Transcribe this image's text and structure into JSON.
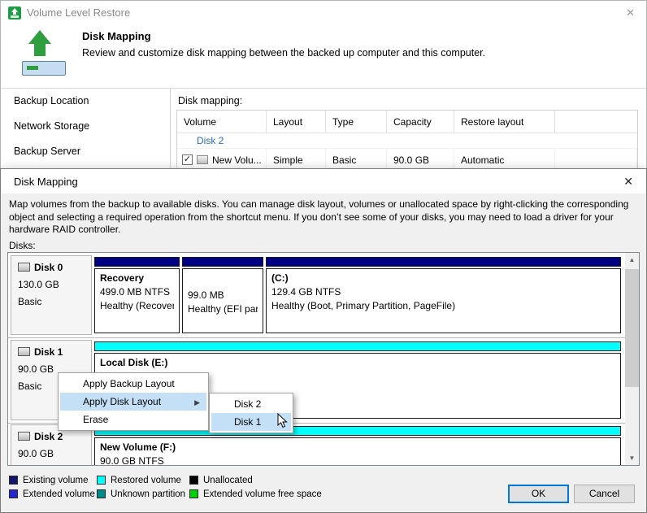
{
  "icons": {
    "close": "✕",
    "submenu_arrow": "▶",
    "scroll_up": "▲",
    "scroll_down": "▼",
    "checkmark": "✓"
  },
  "background": {
    "window_title": "Volume Level Restore",
    "header": {
      "title": "Disk Mapping",
      "description": "Review and customize disk mapping between the backed up computer and this computer."
    },
    "sidebar": {
      "items": [
        {
          "label": "Backup Location"
        },
        {
          "label": "Network Storage"
        },
        {
          "label": "Backup Server"
        }
      ]
    },
    "table": {
      "label": "Disk mapping:",
      "columns": [
        {
          "label": "Volume"
        },
        {
          "label": "Layout"
        },
        {
          "label": "Type"
        },
        {
          "label": "Capacity"
        },
        {
          "label": "Restore layout"
        }
      ],
      "group_row": {
        "label": "Disk 2"
      },
      "row": {
        "volume": "New Volu...",
        "layout": "Simple",
        "type": "Basic",
        "capacity": "90.0 GB",
        "restore_layout": "Automatic",
        "checked": true
      }
    }
  },
  "dialog": {
    "title": "Disk Mapping",
    "description": "Map volumes from the backup to available disks. You can manage disk layout, volumes or unallocated space by right-clicking the corresponding object and selecting a required operation from the shortcut menu. If you don’t see some of your disks, you may need to load a driver for your hardware RAID controller.",
    "disks_label": "Disks:",
    "disks": [
      {
        "name": "Disk 0",
        "size": "130.0 GB",
        "kind": "Basic",
        "partitions": [
          {
            "name": "Recovery",
            "size": "499.0 MB NTFS",
            "status": "Healthy (Recovery",
            "color": "#000082"
          },
          {
            "name": "",
            "size": "99.0 MB",
            "status": "Healthy (EFI parti",
            "color": "#000082"
          },
          {
            "name": "(C:)",
            "size": "129.4 GB NTFS",
            "status": "Healthy (Boot, Primary Partition, PageFile)",
            "color": "#000082"
          }
        ]
      },
      {
        "name": "Disk 1",
        "size": "90.0 GB",
        "kind": "Basic",
        "partitions": [
          {
            "name": "Local Disk (E:)",
            "size": "",
            "status": "",
            "color": "#00ffff"
          }
        ]
      },
      {
        "name": "Disk 2",
        "size": "90.0 GB",
        "kind": "Basic",
        "partitions": [
          {
            "name": "New Volume (F:)",
            "size": "90.0 GB NTFS",
            "status": "",
            "color": "#00ffff"
          }
        ]
      }
    ],
    "context_menu": {
      "items": [
        {
          "label": "Apply Backup Layout"
        },
        {
          "label": "Apply Disk Layout"
        },
        {
          "label": "Erase"
        }
      ],
      "highlighted": "Apply Disk Layout"
    },
    "submenu": {
      "items": [
        {
          "label": "Disk 2"
        },
        {
          "label": "Disk 1"
        }
      ],
      "highlighted": "Disk 1"
    },
    "legend": {
      "row1": [
        {
          "label": "Existing volume",
          "color": "#15156b"
        },
        {
          "label": "Restored volume",
          "color": "#00ffff"
        },
        {
          "label": "Unallocated",
          "color": "#000000"
        }
      ],
      "row2": [
        {
          "label": "Extended volume",
          "color": "#2626cd"
        },
        {
          "label": "Unknown partition",
          "color": "#008b8b"
        },
        {
          "label": "Extended volume free space",
          "color": "#00cf00"
        }
      ]
    },
    "buttons": {
      "ok": "OK",
      "cancel": "Cancel"
    }
  }
}
